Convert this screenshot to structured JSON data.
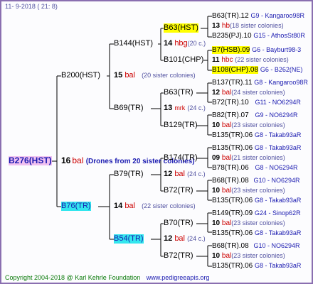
{
  "header": {
    "date": "11-  9-2018 (  21:  8)"
  },
  "footer": {
    "copyright": "Copyright 2004-2018 @ Karl Kehrle Foundation",
    "site": "www.pedigreeapis.org"
  },
  "colors": {
    "frame": "#8a6fb0",
    "line": "#000000",
    "highlight_yellow": "#ffff00",
    "highlight_cyan": "#33e6ee",
    "highlight_pink": "#f0c0f0",
    "red": "#cc0000",
    "blue": "#1a1ab0",
    "green": "#0a7a0a"
  },
  "root": {
    "name": "B276(HST)",
    "num": "16",
    "unit": "bal",
    "note": "(Drones from 20 sister colonies)"
  },
  "gen1": [
    {
      "name": "B200(HST)",
      "num": "15",
      "unit": "bal",
      "note": "(20 sister colonies)"
    },
    {
      "name": "B76(TR)",
      "num": "14",
      "unit": "bal",
      "note": "(22 sister colonies)"
    }
  ],
  "gen2": [
    {
      "name": "B144(HST)",
      "num": "14",
      "unit": "hbg",
      "note": "(20 c.)"
    },
    {
      "name": "B69(TR)",
      "num": "13",
      "unit": "mrk",
      "note": "(24 c.)"
    },
    {
      "name": "B79(TR)",
      "num": "12",
      "unit": "bal",
      "note": "(24 c.)"
    },
    {
      "name": "B54(TR)",
      "num": "12",
      "unit": "bal",
      "note": "(24 c.)"
    }
  ],
  "gen3": [
    {
      "name": "B63(HST)",
      "num": "14",
      "unit": "hbg",
      "note": "(20 c.)"
    },
    {
      "name": "B101(CHP)",
      "num": "11",
      "unit": "hbc",
      "note": ""
    },
    {
      "name": "B63(TR)",
      "num": "12",
      "unit": "bal",
      "note": "(24 c.)"
    },
    {
      "name": "B129(TR)",
      "num": "10",
      "unit": "bal",
      "note": ""
    },
    {
      "name": "B174(TR)",
      "num": "12",
      "unit": "bal",
      "note": "(24 c.)"
    },
    {
      "name": "B72(TR)",
      "num": "10",
      "unit": "bal",
      "note": ""
    },
    {
      "name": "B70(TR)",
      "num": "10",
      "unit": "bal",
      "note": ""
    },
    {
      "name": "B72(TR)",
      "num": "10",
      "unit": "bal",
      "note": ""
    }
  ],
  "gen4": [
    {
      "a": "B63(TR).12",
      "b": "G9 - Kangaroo98R",
      "n": "13",
      "u": "hb",
      "c": "(18 sister colonies)",
      "z": "B235(PJ).10",
      "w": "G15 - AthosSt80R"
    },
    {
      "a": "B7(HSB).09",
      "b": "G6 - Bayburt98-3",
      "n": "11",
      "u": "hbc",
      "c": "(22 sister colonies)",
      "z": "B108(CHP).08",
      "w": "G6 - B262(NE)"
    },
    {
      "a": "B137(TR).11",
      "b": "G8 - Kangaroo98R",
      "n": "12",
      "u": "bal",
      "c": "(24 sister colonies)",
      "z": "B72(TR).10",
      "w": "G11 - NO6294R"
    },
    {
      "a": "B82(TR).07",
      "b": "G9 - NO6294R",
      "n": "10",
      "u": "bal",
      "c": "(23 sister colonies)",
      "z": "B135(TR).06",
      "w": "G8 - Takab93aR"
    },
    {
      "a": "B135(TR).06",
      "b": "G8 - Takab93aR",
      "n": "09",
      "u": "bal",
      "c": "(21 sister colonies)",
      "z": "B78(TR).06",
      "w": "G8 - NO6294R"
    },
    {
      "a": "B68(TR).08",
      "b": "G10 - NO6294R",
      "n": "10",
      "u": "bal",
      "c": "(23 sister colonies)",
      "z": "B135(TR).06",
      "w": "G8 - Takab93aR"
    },
    {
      "a": "B149(TR).09",
      "b": "G24 - Sinop62R",
      "n": "10",
      "u": "bal",
      "c": "(23 sister colonies)",
      "z": "B135(TR).06",
      "w": "G8 - Takab93aR"
    },
    {
      "a": "B68(TR).08",
      "b": "G10 - NO6294R",
      "n": "10",
      "u": "bal",
      "c": "(23 sister colonies)",
      "z": "B135(TR).06",
      "w": "G8 - Takab93aR"
    }
  ]
}
